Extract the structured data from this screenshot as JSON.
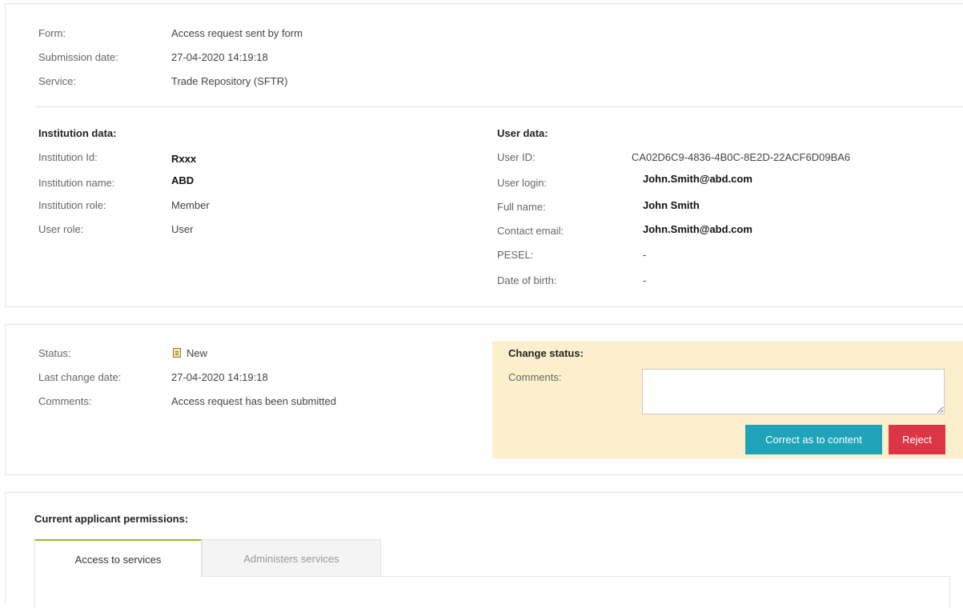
{
  "form_info": {
    "form_label": "Form:",
    "form_value": "Access request sent by form",
    "submission_label": "Submission date:",
    "submission_value": "27-04-2020 14:19:18",
    "service_label": "Service:",
    "service_value": "Trade Repository (SFTR)"
  },
  "institution": {
    "heading": "Institution data:",
    "id_label": "Institution Id:",
    "id_value": "Rxxx",
    "name_label": "Institution name:",
    "name_value": "ABD",
    "role_label": "Institution role:",
    "role_value": "Member",
    "user_role_label": "User role:",
    "user_role_value": "User"
  },
  "user": {
    "heading": "User data:",
    "id_label": "User ID:",
    "id_value": "CA02D6C9-4836-4B0C-8E2D-22ACF6D09BA6",
    "login_label": "User login:",
    "login_value": "John.Smith@abd.com",
    "fullname_label": "Full name:",
    "fullname_value": "John Smith",
    "email_label": "Contact email:",
    "email_value": "John.Smith@abd.com",
    "pesel_label": "PESEL:",
    "pesel_value": "-",
    "dob_label": "Date of birth:",
    "dob_value": "-"
  },
  "status": {
    "status_label": "Status:",
    "status_value": "New",
    "status_icon": "document-icon",
    "last_change_label": "Last change date:",
    "last_change_value": "27-04-2020 14:19:18",
    "comments_label": "Comments:",
    "comments_value": "Access request has been submitted"
  },
  "change_status": {
    "heading": "Change status:",
    "comments_label": "Comments:",
    "comments_value": "",
    "correct_button": "Correct as to content",
    "reject_button": "Reject",
    "colors": {
      "box_bg": "#fbf0cb",
      "correct": "#1fa3b9",
      "reject": "#dc3545"
    }
  },
  "permissions": {
    "heading": "Current applicant permissions:",
    "tabs": [
      {
        "label": "Access to services",
        "active": true
      },
      {
        "label": "Administers services",
        "active": false
      }
    ],
    "colors": {
      "active_tab_accent": "#8fbf1f"
    }
  }
}
